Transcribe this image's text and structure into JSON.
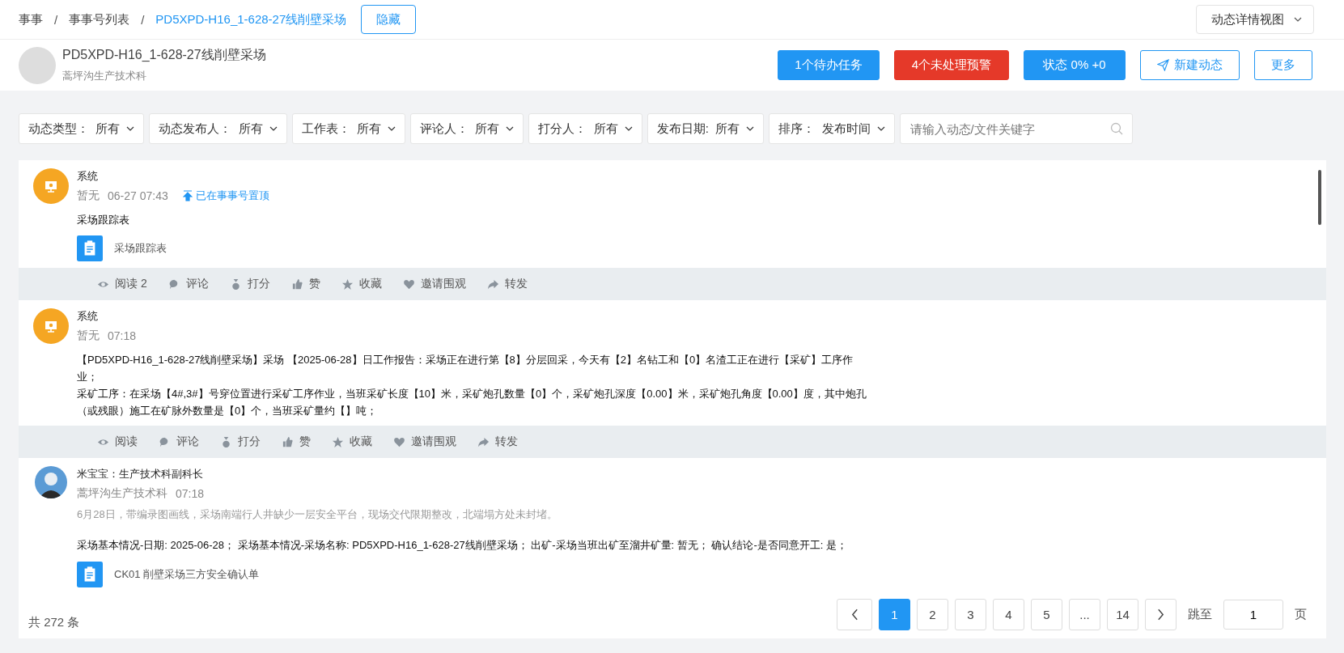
{
  "breadcrumb": {
    "items": [
      {
        "label": "事事",
        "current": false
      },
      {
        "label": "事事号列表",
        "current": false
      },
      {
        "label": "PD5XPD-H16_1-628-27线削壁采场",
        "current": true
      }
    ],
    "separator": "/",
    "hide_button": "隐藏"
  },
  "view_select": {
    "value": "动态详情视图"
  },
  "project": {
    "title": "PD5XPD-H16_1-628-27线削壁采场",
    "department": "蒿坪沟生产技术科"
  },
  "actions": [
    {
      "label": "1个待办任务",
      "kind": "primary"
    },
    {
      "label": "4个未处理预警",
      "kind": "danger"
    },
    {
      "label": "状态 0% +0",
      "kind": "primary"
    },
    {
      "label": "新建动态",
      "kind": "outline-send"
    },
    {
      "label": "更多",
      "kind": "outline"
    }
  ],
  "filters": [
    {
      "label": "动态类型：",
      "value": "所有"
    },
    {
      "label": "动态发布人：",
      "value": "所有"
    },
    {
      "label": "工作表：",
      "value": "所有"
    },
    {
      "label": "评论人：",
      "value": "所有"
    },
    {
      "label": "打分人：",
      "value": "所有"
    },
    {
      "label": "发布日期:",
      "value": "所有"
    },
    {
      "label": "排序：",
      "value": "发布时间"
    }
  ],
  "search": {
    "placeholder": "请输入动态/文件关键字"
  },
  "posts": [
    {
      "author": "系统",
      "kind": "system",
      "meta": [
        "暂无",
        "06-27 07:43"
      ],
      "pinned": "已在事事号置顶",
      "title": "采场跟踪表",
      "attachment": "采场跟踪表",
      "stats": [
        {
          "kind": "read",
          "label": "阅读",
          "count": "2"
        },
        {
          "kind": "comment",
          "label": "评论"
        },
        {
          "kind": "score",
          "label": "打分"
        },
        {
          "kind": "like",
          "label": "赞"
        },
        {
          "kind": "favorite",
          "label": "收藏"
        },
        {
          "kind": "invite",
          "label": "邀请围观"
        },
        {
          "kind": "forward",
          "label": "转发"
        }
      ]
    },
    {
      "author": "系统",
      "kind": "system",
      "meta": [
        "暂无",
        "07:18"
      ],
      "paragraphs": [
        "【PD5XPD-H16_1-628-27线削壁采场】采场 【2025-06-28】日工作报告：采场正在进行第【8】分层回采，今天有【2】名钻工和【0】名渣工正在进行【采矿】工序作业；",
        "采矿工序：在采场【4#,3#】号穿位置进行采矿工序作业，当班采矿长度【10】米，采矿炮孔数量【0】个，采矿炮孔深度【0.00】米，采矿炮孔角度【0.00】度，其中炮孔（或残眼）施工在矿脉外数量是【0】个，当班采矿量约【】吨；"
      ],
      "stats": [
        {
          "kind": "read",
          "label": "阅读"
        },
        {
          "kind": "comment",
          "label": "评论"
        },
        {
          "kind": "score",
          "label": "打分"
        },
        {
          "kind": "like",
          "label": "赞"
        },
        {
          "kind": "favorite",
          "label": "收藏"
        },
        {
          "kind": "invite",
          "label": "邀请围观"
        },
        {
          "kind": "forward",
          "label": "转发"
        }
      ]
    },
    {
      "author": "米宝宝：生产技术科副科长",
      "kind": "user",
      "meta": [
        "蒿坪沟生产技术科",
        "07:18"
      ],
      "note": "6月28日，带编录图画线，采场南端行人井缺少一层安全平台，现场交代限期整改，北端塌方处未封堵。",
      "paragraphs": [
        "采场基本情况-日期: 2025-06-28；  采场基本情况-采场名称: PD5XPD-H16_1-628-27线削壁采场；  出矿-采场当班出矿至溜井矿量: 暂无；  确认结论-是否同意开工: 是；"
      ],
      "attachment": "CK01 削壁采场三方安全确认单"
    }
  ],
  "pagination": {
    "total": "共 272 条",
    "pages": [
      {
        "label": "1",
        "selected": true
      },
      {
        "label": "2",
        "selected": false
      },
      {
        "label": "3",
        "selected": false
      },
      {
        "label": "4",
        "selected": false
      },
      {
        "label": "5",
        "selected": false
      },
      {
        "label": "...",
        "selected": false
      },
      {
        "label": "14",
        "selected": false
      }
    ],
    "jump_label": "跳至",
    "jump_value": "1",
    "unit": "页"
  }
}
